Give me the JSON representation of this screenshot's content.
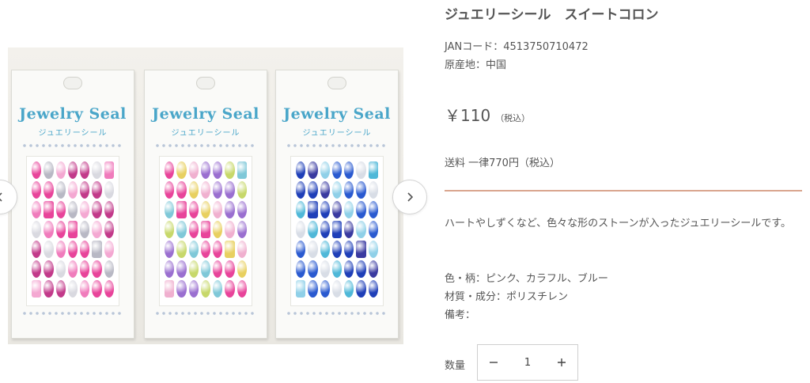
{
  "product": {
    "title": "ジュエリーシール　スイートコロン",
    "jan": "JANコード：4513750710472",
    "origin": "原産地：中国",
    "price": "￥110",
    "price_tax": "（税込）",
    "shipping": "送料 一律770円（税込）",
    "description": "ハートやしずくなど、色々な形のストーンが入ったジュエリーシールです。",
    "specs": [
      "色・柄：ピンク、カラフル、ブルー",
      "材質・成分：ポリスチレン",
      "備考："
    ],
    "quantity_label": "数量",
    "quantity_value": "1"
  },
  "gallery": {
    "packs": [
      {
        "brand": "Jewelry Seal",
        "subtitle": "ジュエリーシール",
        "palette": [
          "#e8449a",
          "#f07cbc",
          "#d9d9e0",
          "#c23a8a",
          "#f4a8d2",
          "#b8b8c4"
        ]
      },
      {
        "brand": "Jewelry Seal",
        "subtitle": "ジュエリーシール",
        "palette": [
          "#e8449a",
          "#7fc8d8",
          "#c7d86a",
          "#9a6fd0",
          "#f0b0cf",
          "#e8d060"
        ]
      },
      {
        "brand": "Jewelry Seal",
        "subtitle": "ジュエリーシール",
        "palette": [
          "#1f3fb8",
          "#4fb8d8",
          "#d8dde6",
          "#2a5ad0",
          "#8fd0e8",
          "#3a3aa0"
        ]
      }
    ],
    "icons": {
      "prev": "chevron-left-icon",
      "next": "chevron-right-icon"
    }
  },
  "stepper_icons": {
    "minus": "minus-icon",
    "plus": "plus-icon"
  }
}
